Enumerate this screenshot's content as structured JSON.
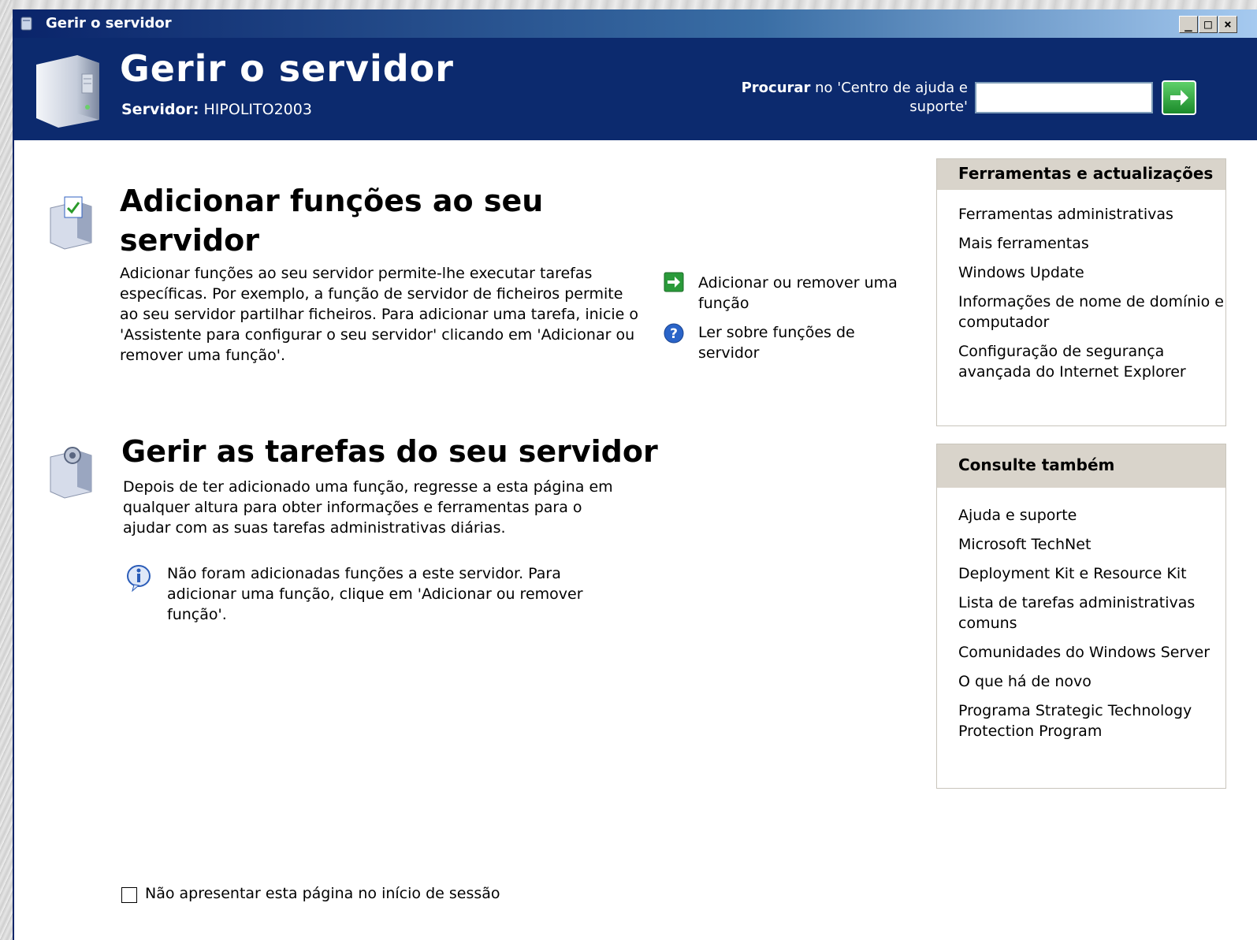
{
  "window": {
    "title": "Gerir o servidor",
    "min_label": "_",
    "max_label": "□",
    "close_label": "×"
  },
  "header": {
    "title": "Gerir o servidor",
    "server_label": "Servidor:",
    "server_name": "HIPOLITO2003",
    "search_label_bold": "Procurar",
    "search_label_rest": " no 'Centro de ajuda e suporte'",
    "search_value": ""
  },
  "roles": {
    "title": "Adicionar funções ao seu servidor",
    "description": "Adicionar funções ao seu servidor permite-lhe executar tarefas específicas. Por exemplo, a função de servidor de ficheiros permite ao seu servidor partilhar ficheiros. Para adicionar uma tarefa, inicie o 'Assistente para configurar o seu servidor' clicando em 'Adicionar ou remover uma função'.",
    "actions": [
      {
        "label": "Adicionar ou remover uma função",
        "icon": "green-arrow-icon"
      },
      {
        "label": "Ler sobre funções de servidor",
        "icon": "help-icon"
      }
    ]
  },
  "tasks": {
    "title": "Gerir as tarefas do seu servidor",
    "description": "Depois de ter adicionado uma função, regresse a esta página em qualquer altura para obter informações e ferramentas para o ajudar com as suas tarefas administrativas diárias.",
    "info": "Não foram adicionadas funções a este servidor. Para adicionar uma função, clique em 'Adicionar ou remover função'."
  },
  "tools_panel": {
    "title": "Ferramentas e actualizações",
    "items": [
      "Ferramentas administrativas",
      "Mais ferramentas",
      "Windows Update",
      "Informações de nome de domínio e computador",
      "Configuração de segurança avançada do Internet Explorer"
    ]
  },
  "see_also_panel": {
    "title": "Consulte também",
    "items": [
      "Ajuda e suporte",
      "Microsoft TechNet",
      "Deployment Kit e Resource Kit",
      "Lista de tarefas administrativas comuns",
      "Comunidades do Windows Server",
      "O que há de novo",
      "Programa Strategic Technology Protection Program"
    ]
  },
  "footer": {
    "checkbox_label": "Não apresentar esta página no início de sessão",
    "checkbox_checked": false
  }
}
